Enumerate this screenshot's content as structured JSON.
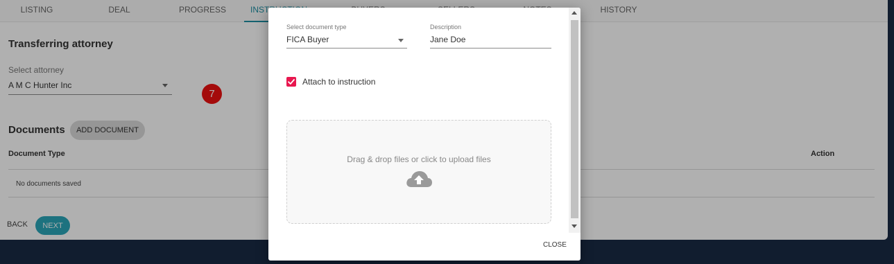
{
  "tabs": [
    {
      "label": "LISTING"
    },
    {
      "label": "DEAL"
    },
    {
      "label": "PROGRESS"
    },
    {
      "label": "INSTRUCTION"
    },
    {
      "label": "BUYERS"
    },
    {
      "label": "SELLERS"
    },
    {
      "label": "NOTES"
    },
    {
      "label": "HISTORY"
    }
  ],
  "main": {
    "section_title": "Transferring attorney",
    "attorney_label": "Select attorney",
    "attorney_value": "A M C Hunter Inc",
    "step_badge": "7",
    "documents_title": "Documents",
    "add_document_label": "ADD DOCUMENT",
    "table": {
      "col_document_type": "Document Type",
      "col_action": "Action",
      "empty_text": "No documents saved"
    },
    "back_label": "BACK",
    "next_label": "NEXT"
  },
  "modal": {
    "doctype_label": "Select document type",
    "doctype_value": "FICA Buyer",
    "description_label": "Description",
    "description_value": "Jane Doe",
    "attach_label": "Attach to instruction",
    "attach_checked": true,
    "dropzone_text": "Drag & drop files or click to upload files",
    "close_label": "CLOSE"
  },
  "colors": {
    "accent": "#2aa6b8",
    "checkbox": "#e8174f",
    "badge": "#ee1111",
    "background": "#1a2a44"
  },
  "icons": {
    "upload": "cloud-upload-icon",
    "dropdown": "chevron-down-icon"
  }
}
